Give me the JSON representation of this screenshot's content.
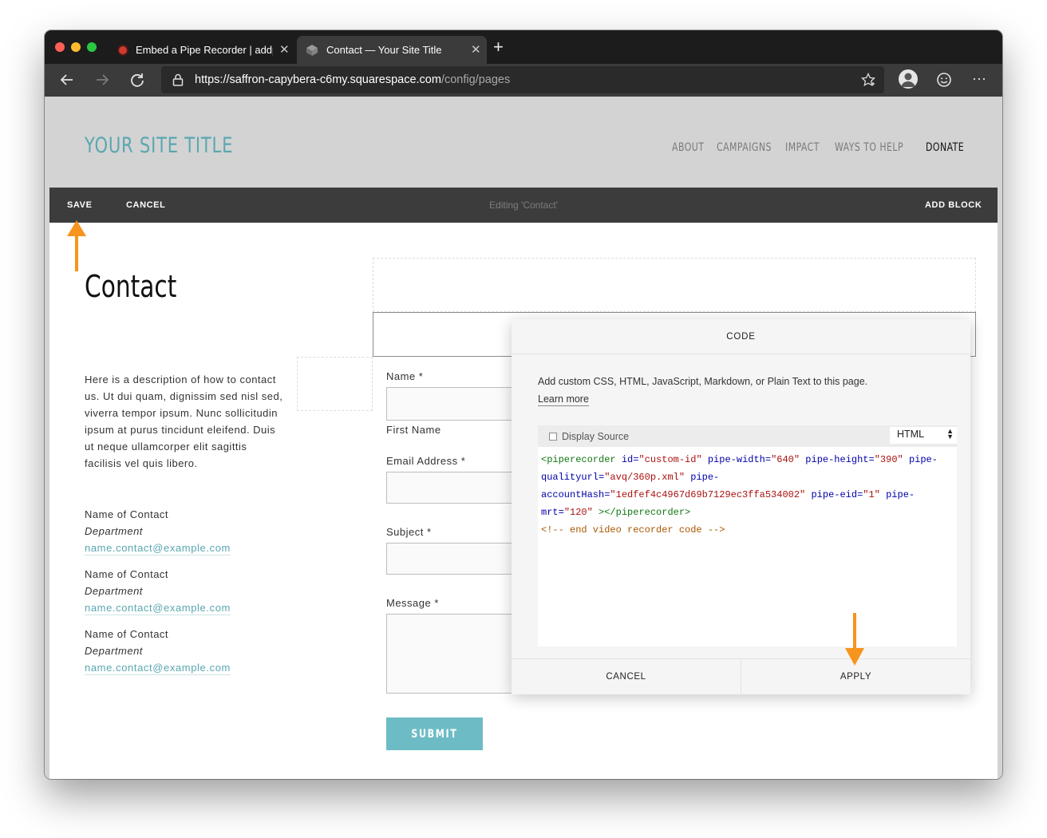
{
  "browser": {
    "tabs": [
      {
        "title": "Embed a Pipe Recorder | addp",
        "active": false
      },
      {
        "title": "Contact — Your Site Title",
        "active": true
      }
    ],
    "url_host": "https://saffron-capybera-c6my.squarespace.com",
    "url_path": "/config/pages"
  },
  "site": {
    "title": "YOUR SITE TITLE",
    "nav": [
      "ABOUT",
      "CAMPAIGNS",
      "IMPACT",
      "WAYS TO HELP",
      "DONATE"
    ]
  },
  "editbar": {
    "save": "SAVE",
    "cancel": "CANCEL",
    "center": "Editing 'Contact'",
    "add_block": "ADD BLOCK"
  },
  "page": {
    "heading": "Contact",
    "description": "Here is a description of how to contact us. Ut dui quam, dignissim sed nisl sed, viverra tempor ipsum. Nunc sollicitudin ipsum at purus tincidunt eleifend. Duis ut neque ullamcorper elit sagittis facilisis vel quis libero.",
    "contacts": [
      {
        "name": "Name of Contact",
        "department": "Department",
        "email": "name.contact@example.com"
      },
      {
        "name": "Name of Contact",
        "department": "Department",
        "email": "name.contact@example.com"
      },
      {
        "name": "Name of Contact",
        "department": "Department",
        "email": "name.contact@example.com"
      }
    ]
  },
  "form": {
    "name_label": "Name *",
    "first_name_sub": "First Name",
    "email_label": "Email Address *",
    "subject_label": "Subject *",
    "message_label": "Message *",
    "submit": "SUBMIT"
  },
  "modal": {
    "title": "CODE",
    "description": "Add custom CSS, HTML, JavaScript, Markdown, or Plain Text to this page.",
    "learn_more": "Learn more",
    "display_source": "Display Source",
    "language": "HTML",
    "code": {
      "line1_tag_open": "<piperecorder",
      "attr_id": "id=",
      "val_id": "\"custom-id\"",
      "attr_width": "pipe-width=",
      "val_width": "\"640\"",
      "attr_height": "pipe-height=",
      "val_height": "\"390\"",
      "attr_quality_a": "pipe-",
      "attr_quality_b": "qualityurl=",
      "val_quality": "\"avq/360p.xml\"",
      "attr_account_a": "pipe-",
      "attr_account_b": "accountHash=",
      "val_account": "\"1edfef4c4967d69b7129ec3ffa534002\"",
      "attr_eid": "pipe-eid=",
      "val_eid": "\"1\"",
      "attr_mrt_a": "pipe-",
      "attr_mrt_b": "mrt=",
      "val_mrt": "\"120\"",
      "tag_close": "></piperecorder>",
      "comment": "<!-- end video recorder code -->"
    },
    "cancel": "CANCEL",
    "apply": "APPLY"
  },
  "colors": {
    "accent": "#5aa7b0",
    "annotation_arrow": "#f7941d"
  }
}
